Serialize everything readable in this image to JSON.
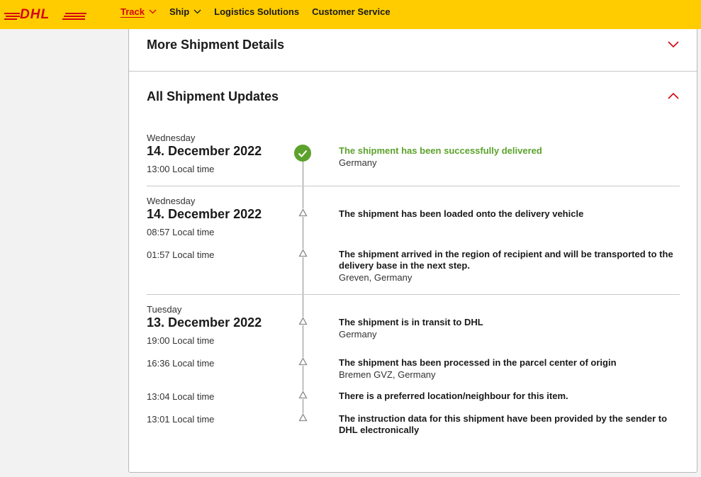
{
  "header": {
    "logo_text": "DHL",
    "nav": [
      {
        "label": "Track",
        "has_chevron": true,
        "active": true
      },
      {
        "label": "Ship",
        "has_chevron": true,
        "active": false
      },
      {
        "label": "Logistics Solutions",
        "has_chevron": false,
        "active": false
      },
      {
        "label": "Customer Service",
        "has_chevron": false,
        "active": false
      }
    ]
  },
  "sections": {
    "more_details": {
      "title": "More Shipment Details",
      "icon": "chevron-down-icon"
    },
    "all_updates": {
      "title": "All Shipment Updates",
      "icon": "chevron-up-icon"
    }
  },
  "updates": [
    {
      "day": "Wednesday",
      "date": "14. December 2022",
      "events": [
        {
          "time": "13:00 Local time",
          "text": "The shipment has been successfully delivered",
          "location": "Germany",
          "status": "delivered"
        }
      ]
    },
    {
      "day": "Wednesday",
      "date": "14. December 2022",
      "events": [
        {
          "time": "08:57 Local time",
          "text": "The shipment has been loaded onto the delivery vehicle",
          "location": "",
          "status": "normal"
        },
        {
          "time": "01:57 Local time",
          "text": "The shipment arrived in the region of recipient and will be transported to the delivery base in the next step.",
          "location": "Greven, Germany",
          "status": "normal"
        }
      ]
    },
    {
      "day": "Tuesday",
      "date": "13. December 2022",
      "events": [
        {
          "time": "19:00 Local time",
          "text": "The shipment is in transit to DHL",
          "location": "Germany",
          "status": "normal"
        },
        {
          "time": "16:36 Local time",
          "text": "The shipment has been processed in the parcel center of origin",
          "location": "Bremen GVZ, Germany",
          "status": "normal"
        },
        {
          "time": "13:04 Local time",
          "text": "There is a preferred location/neighbour for this item.",
          "location": "",
          "status": "normal"
        },
        {
          "time": "13:01 Local time",
          "text": "The instruction data for this shipment have been provided by the sender to DHL electronically",
          "location": "",
          "status": "normal"
        }
      ]
    }
  ],
  "colors": {
    "brand_yellow": "#ffcc00",
    "brand_red": "#d40511",
    "delivered_green": "#5ca22c"
  }
}
